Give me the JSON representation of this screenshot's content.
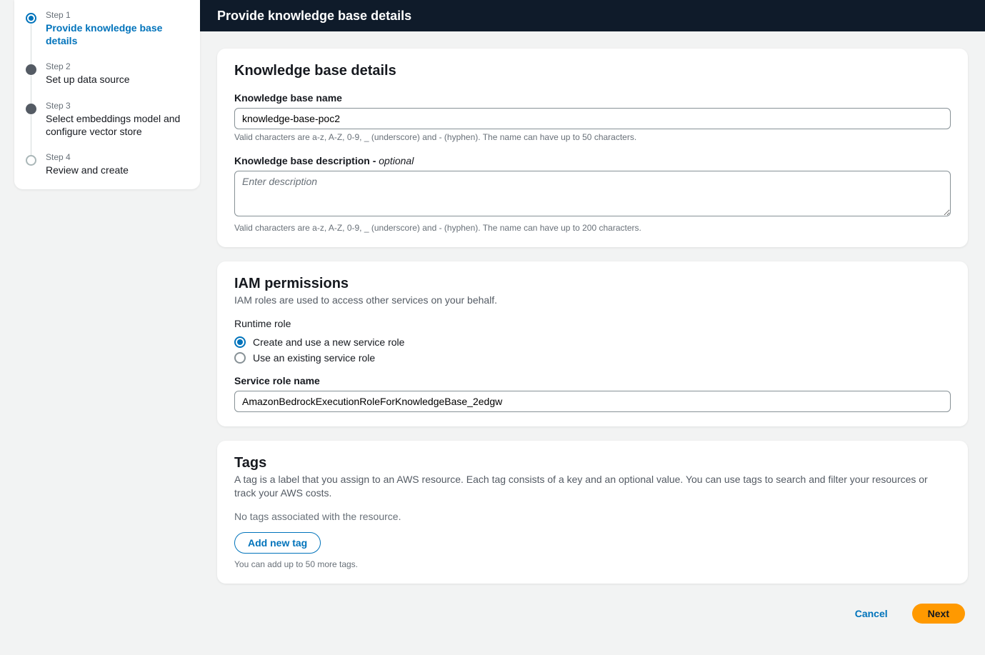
{
  "header": {
    "title": "Provide knowledge base details"
  },
  "sidebar": {
    "steps": [
      {
        "label": "Step 1",
        "title": "Provide knowledge base details"
      },
      {
        "label": "Step 2",
        "title": "Set up data source"
      },
      {
        "label": "Step 3",
        "title": "Select embeddings model and configure vector store"
      },
      {
        "label": "Step 4",
        "title": "Review and create"
      }
    ]
  },
  "details": {
    "heading": "Knowledge base details",
    "name_label": "Knowledge base name",
    "name_value": "knowledge-base-poc2",
    "name_hint": "Valid characters are a-z, A-Z, 0-9, _ (underscore) and - (hyphen). The name can have up to 50 characters.",
    "desc_label": "Knowledge base description - ",
    "desc_optional": "optional",
    "desc_placeholder": "Enter description",
    "desc_value": "",
    "desc_hint": "Valid characters are a-z, A-Z, 0-9, _ (underscore) and - (hyphen). The name can have up to 200 characters."
  },
  "iam": {
    "heading": "IAM permissions",
    "description": "IAM roles are used to access other services on your behalf.",
    "runtime_label": "Runtime role",
    "radio_create": "Create and use a new service role",
    "radio_existing": "Use an existing service role",
    "role_label": "Service role name",
    "role_value": "AmazonBedrockExecutionRoleForKnowledgeBase_2edgw"
  },
  "tags": {
    "heading": "Tags",
    "description": "A tag is a label that you assign to an AWS resource. Each tag consists of a key and an optional value. You can use tags to search and filter your resources or track your AWS costs.",
    "empty": "No tags associated with the resource.",
    "add_label": "Add new tag",
    "hint": "You can add up to 50 more tags."
  },
  "footer": {
    "cancel": "Cancel",
    "next": "Next"
  }
}
